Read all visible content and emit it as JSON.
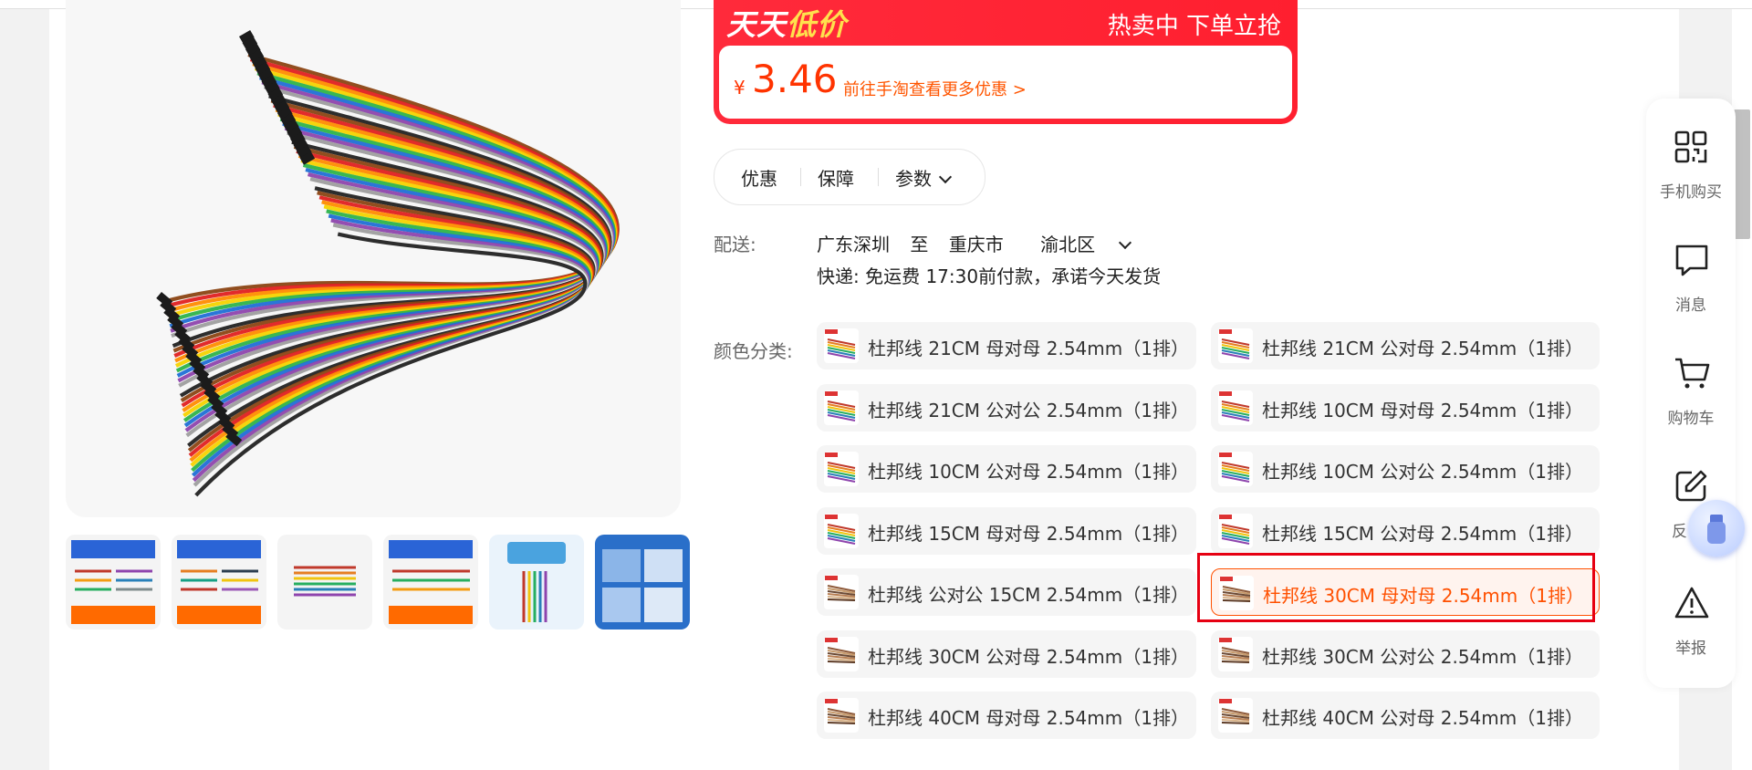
{
  "price_banner": {
    "badge_prefix": "天天",
    "badge_highlight": "低价",
    "promo_text": "热卖中 下单立抢",
    "currency": "¥",
    "price": "3.46",
    "more_link": "前往手淘查看更多优惠 >"
  },
  "tabs": [
    {
      "label": "优惠"
    },
    {
      "label": "保障"
    },
    {
      "label": "参数"
    }
  ],
  "delivery": {
    "label": "配送:",
    "origin": "广东深圳",
    "to": "至",
    "city": "重庆市",
    "district": "渝北区",
    "shipping": "快递: 免运费  17:30前付款，承诺今天发货"
  },
  "sku": {
    "label": "颜色分类:",
    "options": [
      {
        "text": "杜邦线 21CM 母对母 2.54mm（1排）"
      },
      {
        "text": "杜邦线 21CM 公对母 2.54mm（1排）"
      },
      {
        "text": "杜邦线 21CM 公对公 2.54mm（1排）"
      },
      {
        "text": "杜邦线 10CM 母对母 2.54mm（1排）"
      },
      {
        "text": "杜邦线 10CM 公对母 2.54mm（1排）"
      },
      {
        "text": "杜邦线 10CM 公对公 2.54mm（1排）"
      },
      {
        "text": "杜邦线 15CM 母对母 2.54mm（1排）"
      },
      {
        "text": "杜邦线 15CM 公对母 2.54mm（1排）"
      },
      {
        "text": "杜邦线 公对公 15CM 2.54mm（1排）"
      },
      {
        "text": "杜邦线 30CM 母对母 2.54mm（1排）"
      },
      {
        "text": "杜邦线 30CM 公对母 2.54mm（1排）"
      },
      {
        "text": "杜邦线 30CM 公对公 2.54mm（1排）"
      },
      {
        "text": "杜邦线 40CM 母对母 2.54mm（1排）"
      },
      {
        "text": "杜邦线 40CM 公对母 2.54mm（1排）"
      }
    ],
    "selected_index": 9
  },
  "toolbar": [
    {
      "label": "手机购买",
      "icon": "qr-code-icon"
    },
    {
      "label": "消息",
      "icon": "chat-icon"
    },
    {
      "label": "购物车",
      "icon": "cart-icon"
    },
    {
      "label": "反",
      "icon": "edit-icon"
    },
    {
      "label": "举报",
      "icon": "warning-icon"
    }
  ],
  "colors": {
    "accent": "#ff5000",
    "banner_red": "#ff2a3b",
    "selection_frame": "#e60012"
  }
}
